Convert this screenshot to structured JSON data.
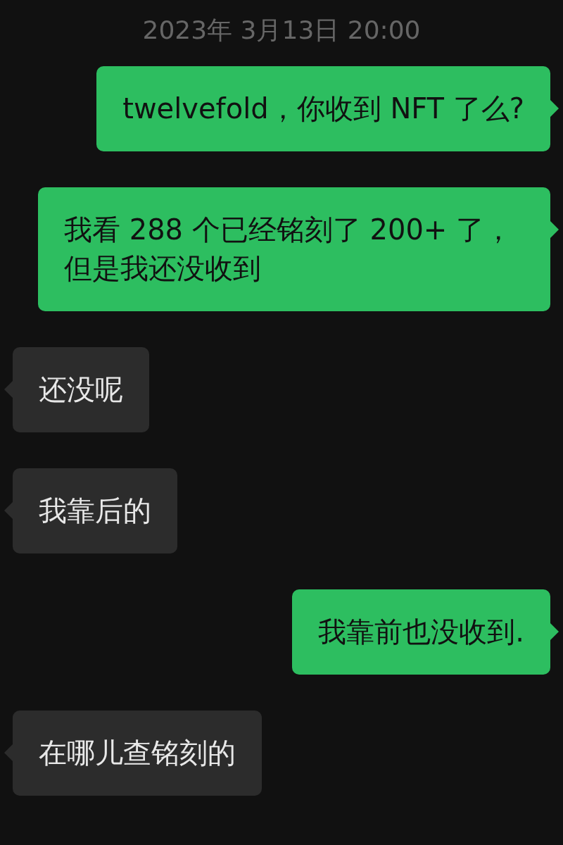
{
  "timestamp": "2023年 3月13日 20:00",
  "messages": [
    {
      "kind": "sent",
      "text": "twelvefold，你收到 NFT 了么?"
    },
    {
      "kind": "sent",
      "text": "我看 288 个已经铭刻了 200+ 了，但是我还没收到"
    },
    {
      "kind": "received",
      "text": "还没呢"
    },
    {
      "kind": "received",
      "text": "我靠后的"
    },
    {
      "kind": "sent",
      "text": "我靠前也没收到."
    },
    {
      "kind": "received",
      "text": "在哪儿查铭刻的"
    }
  ]
}
